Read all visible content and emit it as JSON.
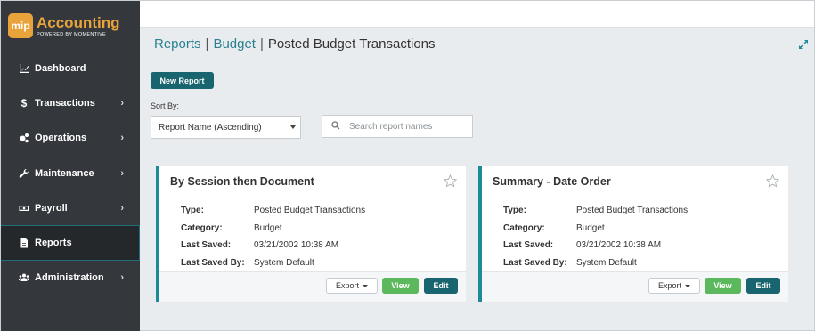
{
  "logo": {
    "badge": "mip",
    "title": "Accounting",
    "subtitle": "POWERED BY MOMENTIVE"
  },
  "sidebar": {
    "items": [
      {
        "label": "Dashboard",
        "icon": "chart-line-icon",
        "has_submenu": false,
        "active": false
      },
      {
        "label": "Transactions",
        "icon": "dollar-icon",
        "has_submenu": true,
        "active": false
      },
      {
        "label": "Operations",
        "icon": "cogs-icon",
        "has_submenu": true,
        "active": false
      },
      {
        "label": "Maintenance",
        "icon": "wrench-icon",
        "has_submenu": true,
        "active": false
      },
      {
        "label": "Payroll",
        "icon": "money-icon",
        "has_submenu": true,
        "active": false
      },
      {
        "label": "Reports",
        "icon": "file-icon",
        "has_submenu": false,
        "active": true
      },
      {
        "label": "Administration",
        "icon": "users-icon",
        "has_submenu": true,
        "active": false
      }
    ]
  },
  "breadcrumb": {
    "part1": "Reports",
    "part2": "Budget",
    "current": "Posted Budget Transactions",
    "separator": "|"
  },
  "toolbar": {
    "new_report_label": "New Report"
  },
  "sort": {
    "label": "Sort By:",
    "value": "Report Name (Ascending)"
  },
  "search": {
    "placeholder": "Search report names"
  },
  "cards": [
    {
      "title": "By Session then Document",
      "fields": [
        {
          "label": "Type:",
          "value": "Posted Budget Transactions"
        },
        {
          "label": "Category:",
          "value": "Budget"
        },
        {
          "label": "Last Saved:",
          "value": "03/21/2002 10:38 AM"
        },
        {
          "label": "Last Saved By:",
          "value": "System Default"
        }
      ],
      "export_label": "Export",
      "view_label": "View",
      "edit_label": "Edit"
    },
    {
      "title": "Summary - Date Order",
      "fields": [
        {
          "label": "Type:",
          "value": "Posted Budget Transactions"
        },
        {
          "label": "Category:",
          "value": "Budget"
        },
        {
          "label": "Last Saved:",
          "value": "03/21/2002 10:38 AM"
        },
        {
          "label": "Last Saved By:",
          "value": "System Default"
        }
      ],
      "export_label": "Export",
      "view_label": "View",
      "edit_label": "Edit"
    }
  ],
  "colors": {
    "accent": "#19656f",
    "link": "#2a8091",
    "brand": "#e8a33a",
    "view": "#5cb85c",
    "sidebar": "#34383d"
  }
}
